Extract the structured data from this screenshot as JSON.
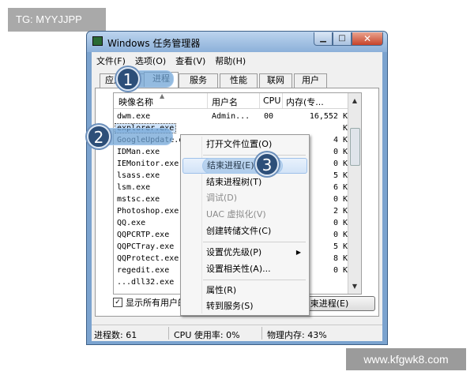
{
  "watermark_top": "TG: MYYJJPP",
  "watermark_bottom": "www.kfgwk8.com",
  "window": {
    "title": "Windows 任务管理器",
    "controls": {
      "minimize": "▁",
      "maximize": "□",
      "close": "✕"
    }
  },
  "menu": [
    "文件(F)",
    "选项(O)",
    "查看(V)",
    "帮助(H)"
  ],
  "tabs": [
    "应用程序",
    "进程",
    "服务",
    "性能",
    "联网",
    "用户"
  ],
  "active_tab": "进程",
  "columns": [
    "映像名称",
    "用户名",
    "CPU",
    "内存(专..."
  ],
  "processes": [
    {
      "name": "dwm.exe",
      "user": "Admin...",
      "cpu": "00",
      "mem": "16,552 K"
    },
    {
      "name": "explorer.exe",
      "user": "",
      "cpu": "",
      "mem": "K"
    },
    {
      "name": "GoogleUpdate.ex",
      "user": "",
      "cpu": "",
      "mem": "4 K"
    },
    {
      "name": "IDMan.exe",
      "user": "",
      "cpu": "",
      "mem": "0 K"
    },
    {
      "name": "IEMonitor.exe",
      "user": "",
      "cpu": "",
      "mem": "0 K"
    },
    {
      "name": "lsass.exe",
      "user": "",
      "cpu": "",
      "mem": "5 K"
    },
    {
      "name": "lsm.exe",
      "user": "",
      "cpu": "",
      "mem": "6 K"
    },
    {
      "name": "mstsc.exe",
      "user": "",
      "cpu": "",
      "mem": "0 K"
    },
    {
      "name": "Photoshop.exe",
      "user": "",
      "cpu": "",
      "mem": "2 K"
    },
    {
      "name": "QQ.exe",
      "user": "",
      "cpu": "",
      "mem": "0 K"
    },
    {
      "name": "QQPCRTP.exe",
      "user": "",
      "cpu": "",
      "mem": "0 K"
    },
    {
      "name": "QQPCTray.exe",
      "user": "",
      "cpu": "",
      "mem": "5 K"
    },
    {
      "name": "QQProtect.exe",
      "user": "",
      "cpu": "",
      "mem": "8 K"
    },
    {
      "name": "regedit.exe",
      "user": "",
      "cpu": "",
      "mem": "0 K"
    },
    {
      "name": "...dll32.exe",
      "user": "",
      "cpu": "",
      "mem": ""
    }
  ],
  "show_all_label": "显示所有用户的",
  "end_process_button": "束进程(E)",
  "status": {
    "processes": "进程数: 61",
    "cpu": "CPU 使用率: 0%",
    "memory": "物理内存: 43%"
  },
  "context_menu": [
    {
      "label": "打开文件位置(O)",
      "disabled": false
    },
    {
      "label": "结束进程(E)",
      "disabled": false,
      "highlighted": true
    },
    {
      "label": "结束进程树(T)",
      "disabled": false
    },
    {
      "label": "调试(D)",
      "disabled": true
    },
    {
      "label": "UAC 虚拟化(V)",
      "disabled": true
    },
    {
      "label": "创建转储文件(C)",
      "disabled": false
    },
    {
      "label": "设置优先级(P)",
      "disabled": false,
      "submenu": true
    },
    {
      "label": "设置相关性(A)...",
      "disabled": false
    },
    {
      "label": "属性(R)",
      "disabled": false
    },
    {
      "label": "转到服务(S)",
      "disabled": false
    }
  ],
  "step_badges": [
    "1",
    "2",
    "3"
  ],
  "icons": {
    "sort": "sort-up-icon",
    "scroll_up": "scroll-up-icon",
    "scroll_down": "scroll-down-icon",
    "submenu": "chevron-right-icon",
    "checkbox": "checkbox-checked-icon"
  }
}
